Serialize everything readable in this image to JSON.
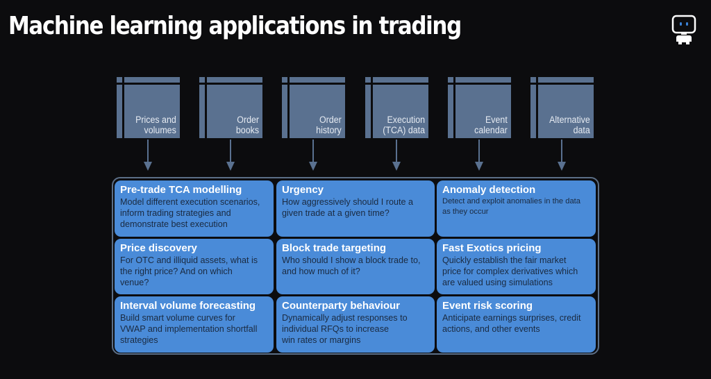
{
  "title": "Machine learning applications in trading",
  "logo": {
    "icon": "robot-mascot-icon",
    "eye_color": "#3b82d6"
  },
  "colors": {
    "background": "#0c0c0e",
    "source_box": "#5a7190",
    "card": "#4a8bd8",
    "card_title": "#ffffff",
    "card_text": "#1a2a40",
    "frame_border": "#5c6f87"
  },
  "data_sources": [
    {
      "label": "Prices and\nvolumes"
    },
    {
      "label": "Order\nbooks"
    },
    {
      "label": "Order\nhistory"
    },
    {
      "label": "Execution\n(TCA) data"
    },
    {
      "label": "Event\ncalendar"
    },
    {
      "label": "Alternative\ndata"
    }
  ],
  "applications": [
    {
      "title": "Pre-trade TCA modelling",
      "description": "Model different execution scenarios,\ninform trading strategies and\ndemonstrate best execution"
    },
    {
      "title": "Urgency",
      "description": "How aggressively should I route a\ngiven trade at a given time?"
    },
    {
      "title": "Anomaly detection",
      "description": "Detect and exploit anomalies in the data\nas they occur"
    },
    {
      "title": "Price discovery",
      "description": "For OTC and illiquid assets, what is\nthe right price?  And on which\nvenue?"
    },
    {
      "title": "Block trade targeting",
      "description": "Who should I show a block trade to,\nand how much of it?"
    },
    {
      "title": "Fast Exotics pricing",
      "description": "Quickly establish the fair market\nprice for complex derivatives which\nare valued using simulations"
    },
    {
      "title": "Interval volume forecasting",
      "description": "Build smart volume curves for\nVWAP and implementation shortfall\nstrategies"
    },
    {
      "title": "Counterparty behaviour",
      "description": "Dynamically adjust responses to\nindividual RFQs to increase\nwin rates or margins"
    },
    {
      "title": "Event risk scoring",
      "description": "Anticipate earnings surprises, credit\nactions, and other events"
    }
  ]
}
